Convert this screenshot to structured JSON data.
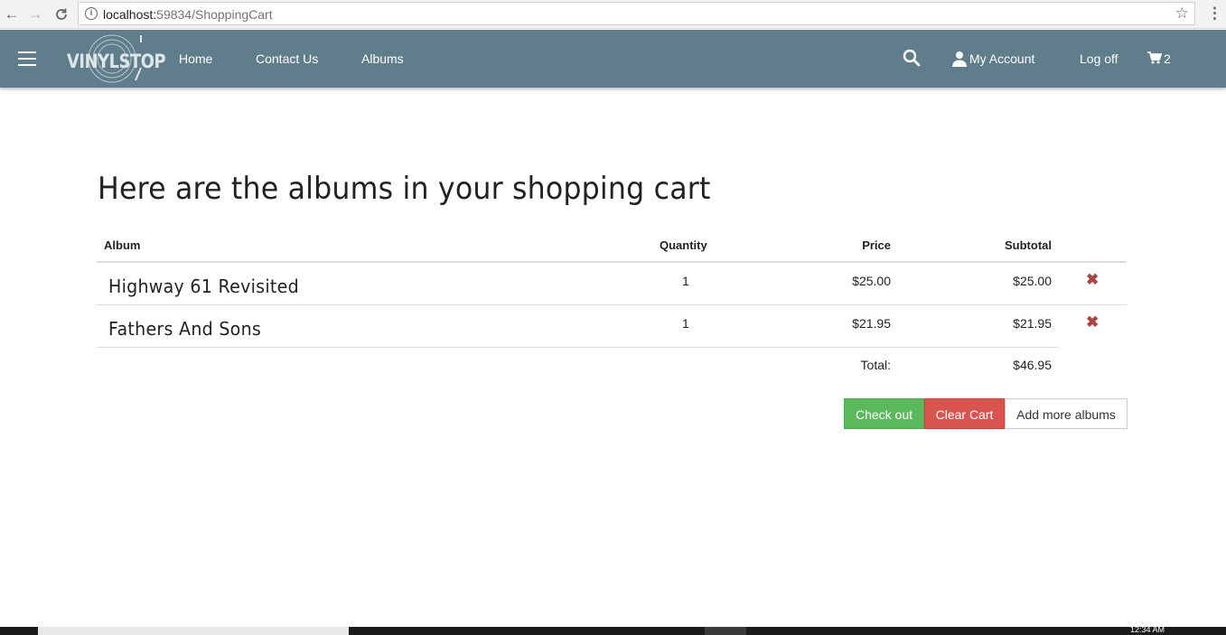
{
  "browser": {
    "url_host": "localhost:",
    "url_rest": "59834/ShoppingCart"
  },
  "navbar": {
    "logo_text": "VINYLSTOP",
    "links": {
      "home": "Home",
      "contact": "Contact Us",
      "albums": "Albums",
      "account": "My Account",
      "logoff": "Log off"
    },
    "cart_count": "2",
    "color": "#607d8b"
  },
  "page": {
    "title": "Here are the albums in your shopping cart"
  },
  "cart": {
    "headers": {
      "album": "Album",
      "quantity": "Quantity",
      "price": "Price",
      "subtotal": "Subtotal"
    },
    "items": [
      {
        "album": "Highway 61 Revisited",
        "quantity": "1",
        "price": "$25.00",
        "subtotal": "$25.00"
      },
      {
        "album": "Fathers And Sons",
        "quantity": "1",
        "price": "$21.95",
        "subtotal": "$21.95"
      }
    ],
    "total_label": "Total:",
    "total_value": "$46.95"
  },
  "buttons": {
    "checkout": "Check out",
    "clear": "Clear Cart",
    "add_more": "Add more albums"
  },
  "taskbar": {
    "clock": "12:34 AM"
  }
}
